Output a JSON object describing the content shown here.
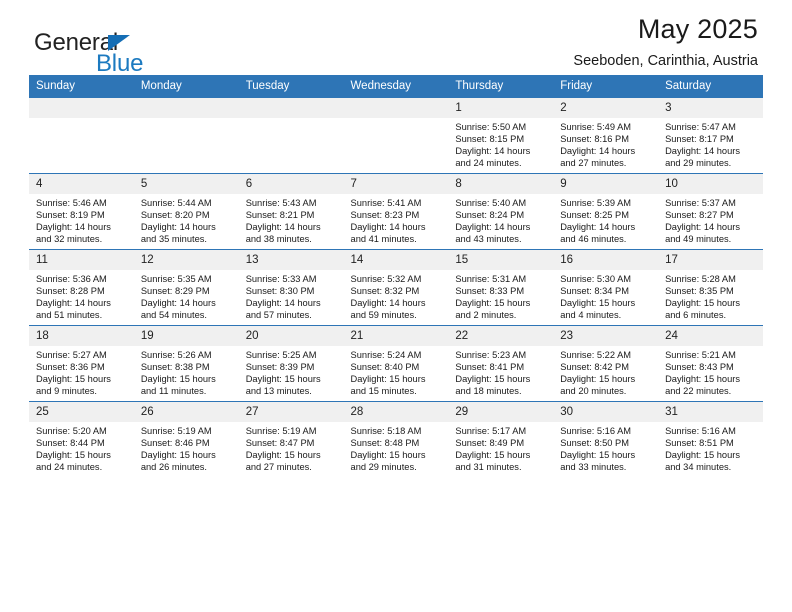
{
  "brand": {
    "name_part1": "General",
    "name_part2": "Blue",
    "logo_icon": "triangle-flag-icon"
  },
  "header": {
    "title": "May 2025",
    "subtitle": "Seeboden, Carinthia, Austria"
  },
  "colors": {
    "header_blue": "#2e75b6",
    "brand_blue": "#1c7ac0",
    "daynum_bg": "#f0f0f0",
    "text": "#1a1a1a"
  },
  "weekday_headers": [
    "Sunday",
    "Monday",
    "Tuesday",
    "Wednesday",
    "Thursday",
    "Friday",
    "Saturday"
  ],
  "labels": {
    "sunrise_prefix": "Sunrise:",
    "sunset_prefix": "Sunset:",
    "daylight_prefix": "Daylight:"
  },
  "weeks": [
    [
      {
        "day": "",
        "empty": true
      },
      {
        "day": "",
        "empty": true
      },
      {
        "day": "",
        "empty": true
      },
      {
        "day": "",
        "empty": true
      },
      {
        "day": "1",
        "sunrise": "Sunrise: 5:50 AM",
        "sunset": "Sunset: 8:15 PM",
        "daylight_line1": "Daylight: 14 hours",
        "daylight_line2": "and 24 minutes."
      },
      {
        "day": "2",
        "sunrise": "Sunrise: 5:49 AM",
        "sunset": "Sunset: 8:16 PM",
        "daylight_line1": "Daylight: 14 hours",
        "daylight_line2": "and 27 minutes."
      },
      {
        "day": "3",
        "sunrise": "Sunrise: 5:47 AM",
        "sunset": "Sunset: 8:17 PM",
        "daylight_line1": "Daylight: 14 hours",
        "daylight_line2": "and 29 minutes."
      }
    ],
    [
      {
        "day": "4",
        "sunrise": "Sunrise: 5:46 AM",
        "sunset": "Sunset: 8:19 PM",
        "daylight_line1": "Daylight: 14 hours",
        "daylight_line2": "and 32 minutes."
      },
      {
        "day": "5",
        "sunrise": "Sunrise: 5:44 AM",
        "sunset": "Sunset: 8:20 PM",
        "daylight_line1": "Daylight: 14 hours",
        "daylight_line2": "and 35 minutes."
      },
      {
        "day": "6",
        "sunrise": "Sunrise: 5:43 AM",
        "sunset": "Sunset: 8:21 PM",
        "daylight_line1": "Daylight: 14 hours",
        "daylight_line2": "and 38 minutes."
      },
      {
        "day": "7",
        "sunrise": "Sunrise: 5:41 AM",
        "sunset": "Sunset: 8:23 PM",
        "daylight_line1": "Daylight: 14 hours",
        "daylight_line2": "and 41 minutes."
      },
      {
        "day": "8",
        "sunrise": "Sunrise: 5:40 AM",
        "sunset": "Sunset: 8:24 PM",
        "daylight_line1": "Daylight: 14 hours",
        "daylight_line2": "and 43 minutes."
      },
      {
        "day": "9",
        "sunrise": "Sunrise: 5:39 AM",
        "sunset": "Sunset: 8:25 PM",
        "daylight_line1": "Daylight: 14 hours",
        "daylight_line2": "and 46 minutes."
      },
      {
        "day": "10",
        "sunrise": "Sunrise: 5:37 AM",
        "sunset": "Sunset: 8:27 PM",
        "daylight_line1": "Daylight: 14 hours",
        "daylight_line2": "and 49 minutes."
      }
    ],
    [
      {
        "day": "11",
        "sunrise": "Sunrise: 5:36 AM",
        "sunset": "Sunset: 8:28 PM",
        "daylight_line1": "Daylight: 14 hours",
        "daylight_line2": "and 51 minutes."
      },
      {
        "day": "12",
        "sunrise": "Sunrise: 5:35 AM",
        "sunset": "Sunset: 8:29 PM",
        "daylight_line1": "Daylight: 14 hours",
        "daylight_line2": "and 54 minutes."
      },
      {
        "day": "13",
        "sunrise": "Sunrise: 5:33 AM",
        "sunset": "Sunset: 8:30 PM",
        "daylight_line1": "Daylight: 14 hours",
        "daylight_line2": "and 57 minutes."
      },
      {
        "day": "14",
        "sunrise": "Sunrise: 5:32 AM",
        "sunset": "Sunset: 8:32 PM",
        "daylight_line1": "Daylight: 14 hours",
        "daylight_line2": "and 59 minutes."
      },
      {
        "day": "15",
        "sunrise": "Sunrise: 5:31 AM",
        "sunset": "Sunset: 8:33 PM",
        "daylight_line1": "Daylight: 15 hours",
        "daylight_line2": "and 2 minutes."
      },
      {
        "day": "16",
        "sunrise": "Sunrise: 5:30 AM",
        "sunset": "Sunset: 8:34 PM",
        "daylight_line1": "Daylight: 15 hours",
        "daylight_line2": "and 4 minutes."
      },
      {
        "day": "17",
        "sunrise": "Sunrise: 5:28 AM",
        "sunset": "Sunset: 8:35 PM",
        "daylight_line1": "Daylight: 15 hours",
        "daylight_line2": "and 6 minutes."
      }
    ],
    [
      {
        "day": "18",
        "sunrise": "Sunrise: 5:27 AM",
        "sunset": "Sunset: 8:36 PM",
        "daylight_line1": "Daylight: 15 hours",
        "daylight_line2": "and 9 minutes."
      },
      {
        "day": "19",
        "sunrise": "Sunrise: 5:26 AM",
        "sunset": "Sunset: 8:38 PM",
        "daylight_line1": "Daylight: 15 hours",
        "daylight_line2": "and 11 minutes."
      },
      {
        "day": "20",
        "sunrise": "Sunrise: 5:25 AM",
        "sunset": "Sunset: 8:39 PM",
        "daylight_line1": "Daylight: 15 hours",
        "daylight_line2": "and 13 minutes."
      },
      {
        "day": "21",
        "sunrise": "Sunrise: 5:24 AM",
        "sunset": "Sunset: 8:40 PM",
        "daylight_line1": "Daylight: 15 hours",
        "daylight_line2": "and 15 minutes."
      },
      {
        "day": "22",
        "sunrise": "Sunrise: 5:23 AM",
        "sunset": "Sunset: 8:41 PM",
        "daylight_line1": "Daylight: 15 hours",
        "daylight_line2": "and 18 minutes."
      },
      {
        "day": "23",
        "sunrise": "Sunrise: 5:22 AM",
        "sunset": "Sunset: 8:42 PM",
        "daylight_line1": "Daylight: 15 hours",
        "daylight_line2": "and 20 minutes."
      },
      {
        "day": "24",
        "sunrise": "Sunrise: 5:21 AM",
        "sunset": "Sunset: 8:43 PM",
        "daylight_line1": "Daylight: 15 hours",
        "daylight_line2": "and 22 minutes."
      }
    ],
    [
      {
        "day": "25",
        "sunrise": "Sunrise: 5:20 AM",
        "sunset": "Sunset: 8:44 PM",
        "daylight_line1": "Daylight: 15 hours",
        "daylight_line2": "and 24 minutes."
      },
      {
        "day": "26",
        "sunrise": "Sunrise: 5:19 AM",
        "sunset": "Sunset: 8:46 PM",
        "daylight_line1": "Daylight: 15 hours",
        "daylight_line2": "and 26 minutes."
      },
      {
        "day": "27",
        "sunrise": "Sunrise: 5:19 AM",
        "sunset": "Sunset: 8:47 PM",
        "daylight_line1": "Daylight: 15 hours",
        "daylight_line2": "and 27 minutes."
      },
      {
        "day": "28",
        "sunrise": "Sunrise: 5:18 AM",
        "sunset": "Sunset: 8:48 PM",
        "daylight_line1": "Daylight: 15 hours",
        "daylight_line2": "and 29 minutes."
      },
      {
        "day": "29",
        "sunrise": "Sunrise: 5:17 AM",
        "sunset": "Sunset: 8:49 PM",
        "daylight_line1": "Daylight: 15 hours",
        "daylight_line2": "and 31 minutes."
      },
      {
        "day": "30",
        "sunrise": "Sunrise: 5:16 AM",
        "sunset": "Sunset: 8:50 PM",
        "daylight_line1": "Daylight: 15 hours",
        "daylight_line2": "and 33 minutes."
      },
      {
        "day": "31",
        "sunrise": "Sunrise: 5:16 AM",
        "sunset": "Sunset: 8:51 PM",
        "daylight_line1": "Daylight: 15 hours",
        "daylight_line2": "and 34 minutes."
      }
    ]
  ]
}
